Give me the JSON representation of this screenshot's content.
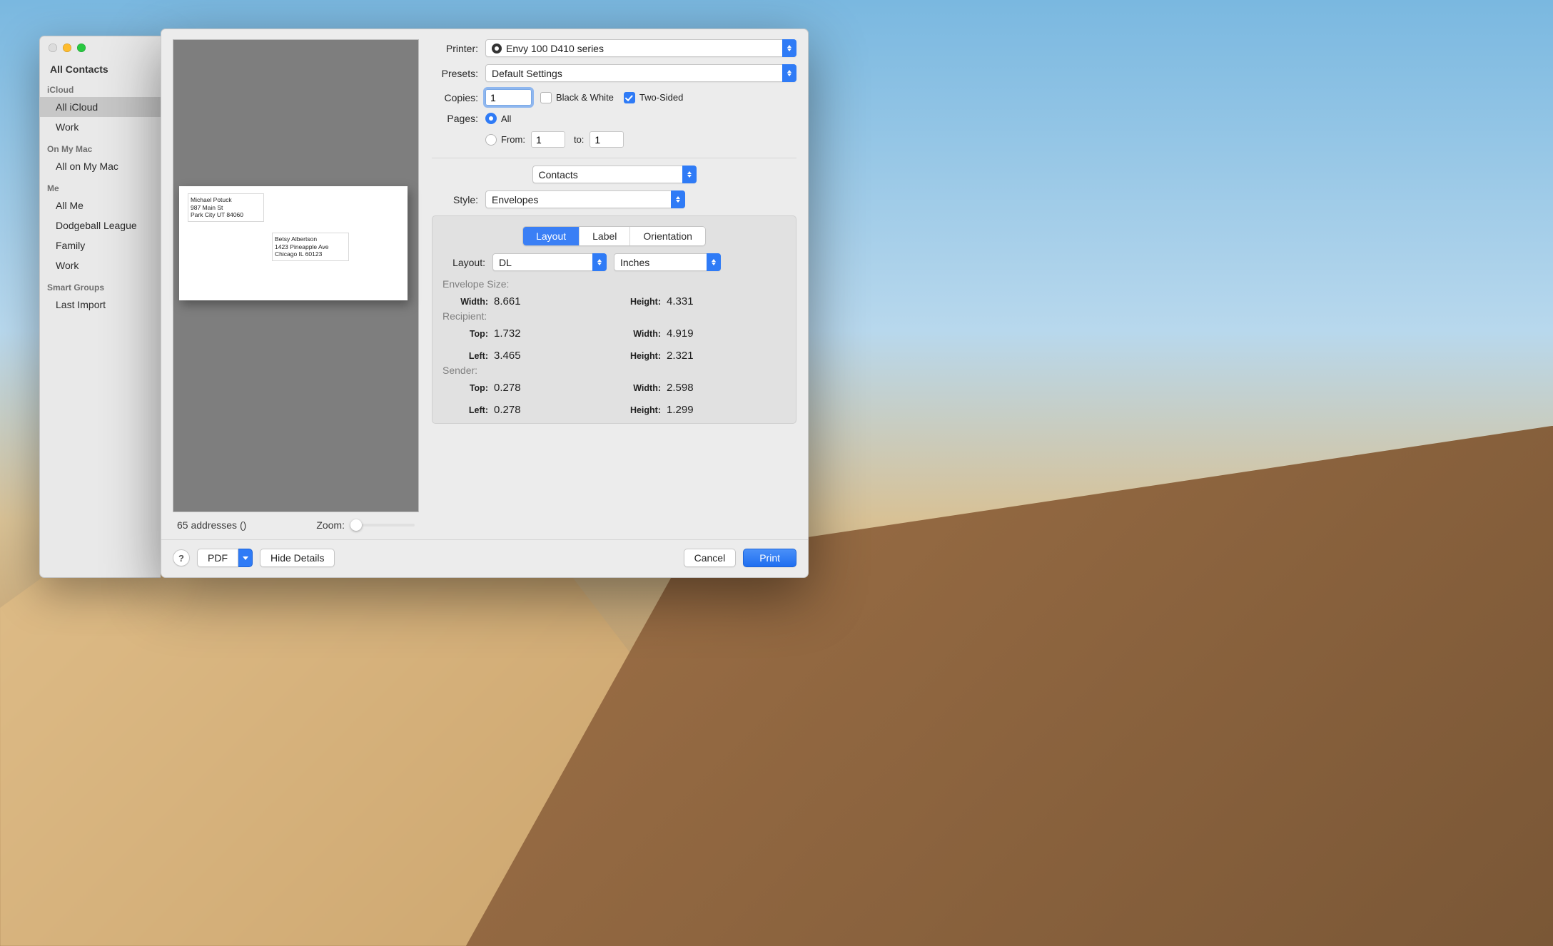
{
  "sidebar": {
    "title": "All Contacts",
    "groups": [
      {
        "name": "iCloud",
        "items": [
          "All iCloud",
          "Work"
        ],
        "selected": "All iCloud"
      },
      {
        "name": "On My Mac",
        "items": [
          "All on My Mac"
        ]
      },
      {
        "name": "Me",
        "items": [
          "All Me",
          "Dodgeball League",
          "Family",
          "Work"
        ]
      },
      {
        "name": "Smart Groups",
        "items": [
          "Last Import"
        ]
      }
    ]
  },
  "preview": {
    "sender": {
      "line1": "Michael Potuck",
      "line2": "987 Main St",
      "line3": "Park City UT 84060"
    },
    "recipient": {
      "line1": "Betsy Albertson",
      "line2": "1423 Pineapple Ave",
      "line3": "Chicago IL 60123"
    },
    "footer_count": "65 addresses ()",
    "zoom_label": "Zoom:"
  },
  "printer": {
    "label": "Printer:",
    "value": "Envy 100 D410 series"
  },
  "presets": {
    "label": "Presets:",
    "value": "Default Settings"
  },
  "copies": {
    "label": "Copies:",
    "value": "1",
    "bw_label": "Black & White",
    "bw_checked": false,
    "two_sided_label": "Two-Sided",
    "two_sided_checked": true
  },
  "pages": {
    "label": "Pages:",
    "all_label": "All",
    "all": true,
    "from_label": "From:",
    "from": "1",
    "to_label": "to:",
    "to": "1"
  },
  "section_select": "Contacts",
  "style": {
    "label": "Style:",
    "value": "Envelopes"
  },
  "tabs": {
    "layout": "Layout",
    "label": "Label",
    "orientation": "Orientation",
    "active": "layout"
  },
  "layout": {
    "label": "Layout:",
    "size": "DL",
    "units": "Inches"
  },
  "env": {
    "title": "Envelope Size:",
    "width_k": "Width:",
    "width": "8.661",
    "height_k": "Height:",
    "height": "4.331"
  },
  "recip": {
    "title": "Recipient:",
    "top_k": "Top:",
    "top": "1.732",
    "width_k": "Width:",
    "width": "4.919",
    "left_k": "Left:",
    "left": "3.465",
    "height_k": "Height:",
    "height": "2.321"
  },
  "sender": {
    "title": "Sender:",
    "top_k": "Top:",
    "top": "0.278",
    "width_k": "Width:",
    "width": "2.598",
    "left_k": "Left:",
    "left": "0.278",
    "height_k": "Height:",
    "height": "1.299"
  },
  "footer": {
    "help": "?",
    "pdf": "PDF",
    "hide": "Hide Details",
    "cancel": "Cancel",
    "print": "Print"
  }
}
